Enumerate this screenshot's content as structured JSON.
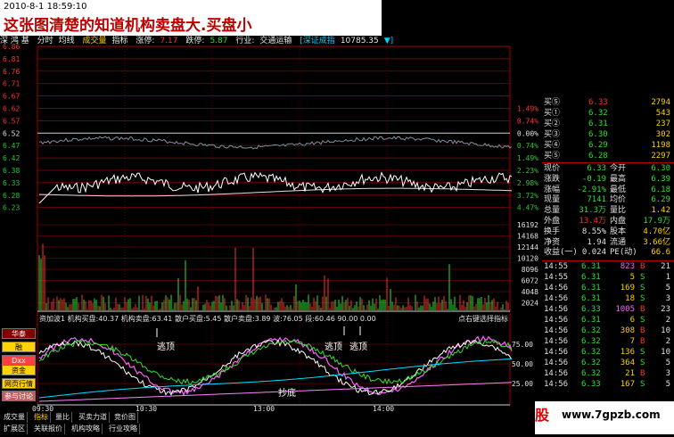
{
  "caption": {
    "timestamp": "2010-8-1 18:59:10",
    "title": "这张图清楚的知道机构卖盘大.买盘小"
  },
  "info_bar": {
    "stock_name": "深 鸿 基",
    "view": "分时",
    "avg_line": "均线",
    "volume": "成交量",
    "indicator": "指标",
    "limit_up_label": "涨停:",
    "limit_up": "7.17",
    "limit_down_label": "跌停:",
    "limit_down": "5.87",
    "industry_label": "行业:",
    "industry": "交通运输",
    "index_name": "[深证成指",
    "index_value": "10785.35",
    "index_arrow": "▼]"
  },
  "price_axis_left": [
    "6.86",
    "6.81",
    "6.76",
    "6.71",
    "6.67",
    "6.62",
    "6.57",
    "6.52",
    "6.47",
    "6.42",
    "6.38",
    "6.33",
    "6.28",
    "6.23"
  ],
  "price_axis_right": [
    "1.49%",
    "0.74%",
    "0.00%",
    "0.74%",
    "1.49%",
    "2.23%",
    "2.98%",
    "3.72%",
    "4.47%"
  ],
  "volume_axis_right": [
    "16192",
    "14168",
    "12144",
    "10120",
    "8096",
    "6072",
    "4048",
    "2024"
  ],
  "indicator_title": {
    "name": "资加波1",
    "items": [
      "机构买盘:40.37",
      "机构卖盘:63.41",
      "散户买盘:5.45",
      "散户卖盘:3.89",
      "波:76.05",
      "段:60.46",
      "90.00",
      "0.00"
    ],
    "hint": "点右键选择指标"
  },
  "indicator_axis_right": [
    "75.00",
    "50.00",
    "25.00"
  ],
  "annotations": [
    "逃顶",
    "逃顶",
    "逃顶",
    "抄底"
  ],
  "sidebar_buttons": [
    "华泰",
    "融",
    "Dxx",
    "资金",
    "网页行情",
    "参与讨论"
  ],
  "time_axis": [
    "09:30",
    "10:30",
    "13:00",
    "14:00"
  ],
  "bottom_tabs_1": [
    "成交量",
    "指标",
    "量比",
    "买卖力道",
    "竞价图"
  ],
  "bottom_tabs_2": [
    "扩展区",
    "关联报价",
    "机构攻略",
    "行业攻略"
  ],
  "quote": {
    "top_partial": {
      "label": "买⑤",
      "price": "6.33",
      "vol": "2794"
    },
    "bids": [
      {
        "label": "买①",
        "price": "6.32",
        "vol": "543"
      },
      {
        "label": "买②",
        "price": "6.31",
        "vol": "237"
      },
      {
        "label": "买③",
        "price": "6.30",
        "vol": "302"
      },
      {
        "label": "买④",
        "price": "6.29",
        "vol": "1198"
      },
      {
        "label": "买⑤",
        "price": "6.28",
        "vol": "2297"
      }
    ],
    "stats": [
      {
        "l1": "现价",
        "v1": "6.33",
        "l2": "今开",
        "v2": "6.30"
      },
      {
        "l1": "涨跌",
        "v1": "-0.19",
        "l2": "最高",
        "v2": "6.39"
      },
      {
        "l1": "涨幅",
        "v1": "-2.91%",
        "l2": "最低",
        "v2": "6.18"
      },
      {
        "l1": "现量",
        "v1": "7141",
        "l2": "均价",
        "v2": "6.29"
      },
      {
        "l1": "总量",
        "v1": "31.3万",
        "l2": "量比",
        "v2": "1.42"
      },
      {
        "l1": "外盘",
        "v1": "13.4万",
        "l2": "内盘",
        "v2": "17.9万"
      },
      {
        "l1": "换手",
        "v1": "8.55%",
        "l2": "股本",
        "v2": "4.70亿"
      },
      {
        "l1": "净资",
        "v1": "1.94",
        "l2": "流通",
        "v2": "3.66亿"
      },
      {
        "l1": "收益(一)",
        "v1": "0.024",
        "l2": "PE(动)",
        "v2": "66.6"
      }
    ],
    "ticks": [
      {
        "t": "14:55",
        "p": "6.31",
        "v": "823",
        "d": "B",
        "n": "21"
      },
      {
        "t": "14:55",
        "p": "6.31",
        "v": "5",
        "d": "S",
        "n": "1"
      },
      {
        "t": "14:56",
        "p": "6.31",
        "v": "169",
        "d": "S",
        "n": "5"
      },
      {
        "t": "14:56",
        "p": "6.31",
        "v": "18",
        "d": "S",
        "n": "3"
      },
      {
        "t": "14:56",
        "p": "6.33",
        "v": "1005",
        "d": "B",
        "n": "23"
      },
      {
        "t": "14:56",
        "p": "6.31",
        "v": "6",
        "d": "S",
        "n": "2"
      },
      {
        "t": "14:56",
        "p": "6.32",
        "v": "308",
        "d": "B",
        "n": "10"
      },
      {
        "t": "14:56",
        "p": "6.32",
        "v": "7",
        "d": "B",
        "n": "2"
      },
      {
        "t": "14:56",
        "p": "6.32",
        "v": "136",
        "d": "S",
        "n": "10"
      },
      {
        "t": "14:56",
        "p": "6.32",
        "v": "364",
        "d": "S",
        "n": "5"
      },
      {
        "t": "14:56",
        "p": "6.32",
        "v": "21",
        "d": "B",
        "n": "3"
      },
      {
        "t": "14:56",
        "p": "6.33",
        "v": "167",
        "d": "S",
        "n": "5"
      }
    ]
  },
  "watermark": {
    "logo": "股",
    "url": "www.7gpzb.com"
  },
  "colors": {
    "up": "#ff3030",
    "down": "#30e030",
    "grid": "#a00000",
    "line": "#e0e0e0"
  }
}
